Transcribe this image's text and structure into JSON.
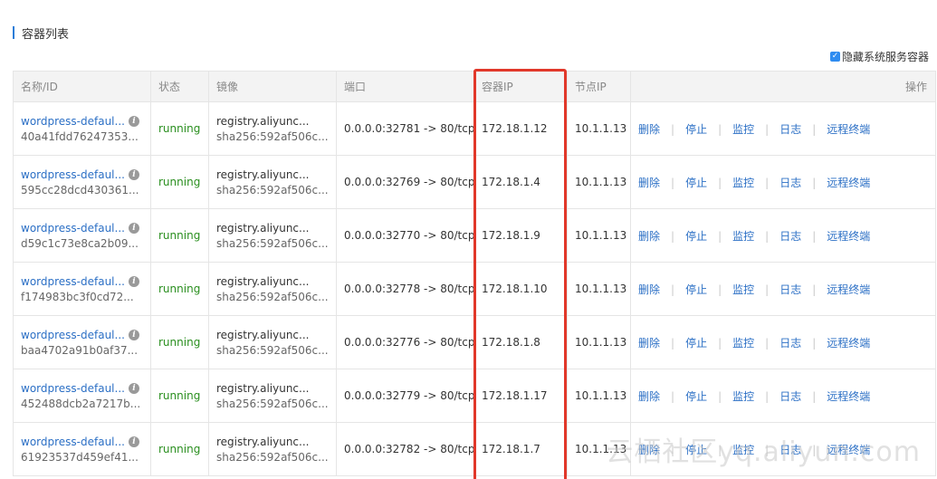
{
  "section_title": "容器列表",
  "hide_system": {
    "label": "隐藏系统服务容器",
    "checked": true
  },
  "columns": [
    "名称/ID",
    "状态",
    "镜像",
    "端口",
    "容器IP",
    "节点IP",
    "操作"
  ],
  "actions": [
    "删除",
    "停止",
    "监控",
    "日志",
    "远程终端"
  ],
  "rows": [
    {
      "name": "wordpress-defaul...",
      "id": "40a41fdd76247353...",
      "status": "running",
      "image": "registry.aliyunc...",
      "digest": "sha256:592af506c...",
      "port": "0.0.0.0:32781 -> 80/tcp",
      "container_ip": "172.18.1.12",
      "node_ip": "10.1.1.13"
    },
    {
      "name": "wordpress-defaul...",
      "id": "595cc28dcd430361...",
      "status": "running",
      "image": "registry.aliyunc...",
      "digest": "sha256:592af506c...",
      "port": "0.0.0.0:32769 -> 80/tcp",
      "container_ip": "172.18.1.4",
      "node_ip": "10.1.1.13"
    },
    {
      "name": "wordpress-defaul...",
      "id": "d59c1c73e8ca2b09...",
      "status": "running",
      "image": "registry.aliyunc...",
      "digest": "sha256:592af506c...",
      "port": "0.0.0.0:32770 -> 80/tcp",
      "container_ip": "172.18.1.9",
      "node_ip": "10.1.1.13"
    },
    {
      "name": "wordpress-defaul...",
      "id": "f174983bc3f0cd72...",
      "status": "running",
      "image": "registry.aliyunc...",
      "digest": "sha256:592af506c...",
      "port": "0.0.0.0:32778 -> 80/tcp",
      "container_ip": "172.18.1.10",
      "node_ip": "10.1.1.13"
    },
    {
      "name": "wordpress-defaul...",
      "id": "baa4702a91b0af37...",
      "status": "running",
      "image": "registry.aliyunc...",
      "digest": "sha256:592af506c...",
      "port": "0.0.0.0:32776 -> 80/tcp",
      "container_ip": "172.18.1.8",
      "node_ip": "10.1.1.13"
    },
    {
      "name": "wordpress-defaul...",
      "id": "452488dcb2a7217b...",
      "status": "running",
      "image": "registry.aliyunc...",
      "digest": "sha256:592af506c...",
      "port": "0.0.0.0:32779 -> 80/tcp",
      "container_ip": "172.18.1.17",
      "node_ip": "10.1.1.13"
    },
    {
      "name": "wordpress-defaul...",
      "id": "61923537d459ef41...",
      "status": "running",
      "image": "registry.aliyunc...",
      "digest": "sha256:592af506c...",
      "port": "0.0.0.0:32782 -> 80/tcp",
      "container_ip": "172.18.1.7",
      "node_ip": "10.1.1.13"
    }
  ],
  "watermark": "云栖社区yq.aliyun.com",
  "colors": {
    "link": "#2b6fc5",
    "running": "#2a8f1f",
    "highlight": "#e1382a",
    "title_bar": "#2b7dd8"
  }
}
